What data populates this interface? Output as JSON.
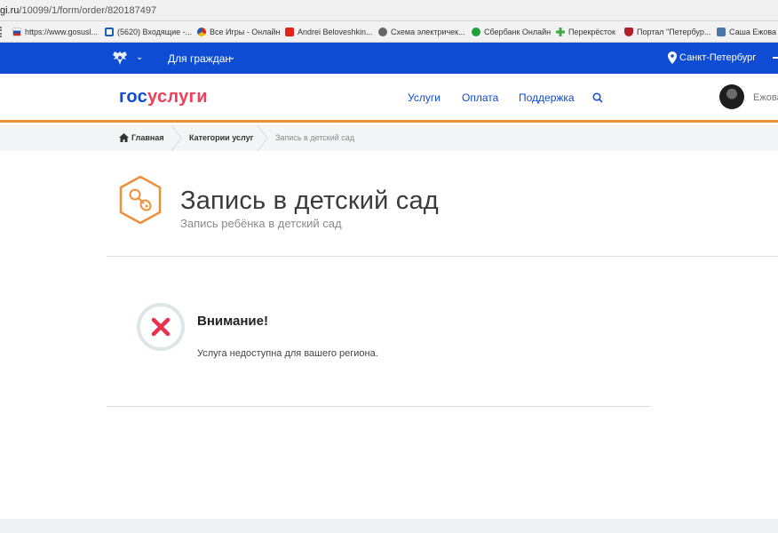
{
  "browser": {
    "url_domain": "gi.ru",
    "url_path": "/10099/1/form/order/820187497"
  },
  "bookmarks": [
    {
      "label": "https://www.gosusl...",
      "icon": "gosuslugi-flag-icon",
      "color": "#d52b1e"
    },
    {
      "label": "(5620) Входящие -...",
      "icon": "mail-icon",
      "color": "#1a5fb4"
    },
    {
      "label": "Все Игры - Онлайн",
      "icon": "games-icon",
      "color": "#f2b600"
    },
    {
      "label": "Andrei Beloveshkin...",
      "icon": "youtube-icon",
      "color": "#e62117"
    },
    {
      "label": "Схема электричек...",
      "icon": "globe-icon",
      "color": "#666666"
    },
    {
      "label": "Сбербанк Онлайн",
      "icon": "sberbank-icon",
      "color": "#21a038"
    },
    {
      "label": "Перекрёсток",
      "icon": "perekrestok-icon",
      "color": "#3aa843"
    },
    {
      "label": "Портал \"Петербур...",
      "icon": "spb-crest-icon",
      "color": "#b11f2a"
    },
    {
      "label": "Саша Ежова",
      "icon": "vk-icon",
      "color": "#4a76a8"
    }
  ],
  "govbar": {
    "citizens_label": "Для граждан",
    "city": "Санкт-Петербург"
  },
  "header": {
    "logo_part1": "гос",
    "logo_part2": "услуги",
    "nav": [
      "Услуги",
      "Оплата",
      "Поддержка"
    ],
    "user_name": "Ежова"
  },
  "breadcrumb": {
    "home": "Главная",
    "categories": "Категории услуг",
    "current": "Запись в детский сад"
  },
  "service": {
    "title": "Запись в детский сад",
    "subtitle": "Запись ребёнка в детский сад"
  },
  "alert": {
    "title": "Внимание!",
    "text": "Услуга недоступна для вашего региона."
  },
  "colors": {
    "gov_blue": "#0d4cd3",
    "brand_red": "#ee3f58",
    "accent_orange": "#ee8f3a",
    "error_red": "#e8304f"
  }
}
